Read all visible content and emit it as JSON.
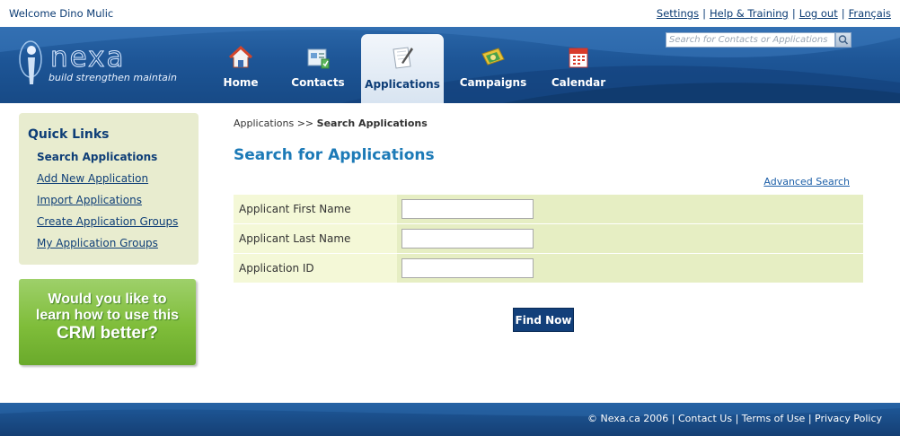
{
  "topbar": {
    "welcome": "Welcome Dino Mulic",
    "links": [
      "Settings",
      "Help & Training",
      "Log out",
      "Français"
    ]
  },
  "logo": {
    "name": "nexa",
    "tagline": "build strengthen maintain"
  },
  "search": {
    "placeholder": "Search for Contacts or Applications"
  },
  "nav": {
    "tabs": [
      {
        "label": "Home",
        "icon": "home-icon"
      },
      {
        "label": "Contacts",
        "icon": "contacts-icon"
      },
      {
        "label": "Applications",
        "icon": "applications-icon",
        "active": true
      },
      {
        "label": "Campaigns",
        "icon": "campaigns-icon"
      },
      {
        "label": "Calendar",
        "icon": "calendar-icon"
      }
    ]
  },
  "sidebar": {
    "title": "Quick Links",
    "items": [
      {
        "label": "Search Applications",
        "current": true
      },
      {
        "label": "Add New Application"
      },
      {
        "label": "Import Applications"
      },
      {
        "label": "Create Application Groups"
      },
      {
        "label": "My Application Groups"
      }
    ],
    "promo": [
      "Would you like to",
      "learn how to use this",
      "CRM better?"
    ]
  },
  "main": {
    "breadcrumb": {
      "parent": "Applications",
      "separator": ">>",
      "current": "Search Applications"
    },
    "title": "Search for Applications",
    "advanced_link": "Advanced Search",
    "fields": [
      {
        "label": "Applicant First Name",
        "value": ""
      },
      {
        "label": "Applicant Last Name",
        "value": ""
      },
      {
        "label": "Application ID",
        "value": ""
      }
    ],
    "submit": "Find Now"
  },
  "footer": {
    "copyright": "© Nexa.ca 2006",
    "links": [
      "Contact Us",
      "Terms of Use",
      "Privacy Policy"
    ]
  },
  "colors": {
    "brand_blue": "#1d5596",
    "title_blue": "#1c7ab7",
    "form_label_bg": "#f4f8d7",
    "form_field_bg": "#e6eec3",
    "sidebar_bg": "#e8eccf",
    "promo_green": "#7fbd3a"
  }
}
